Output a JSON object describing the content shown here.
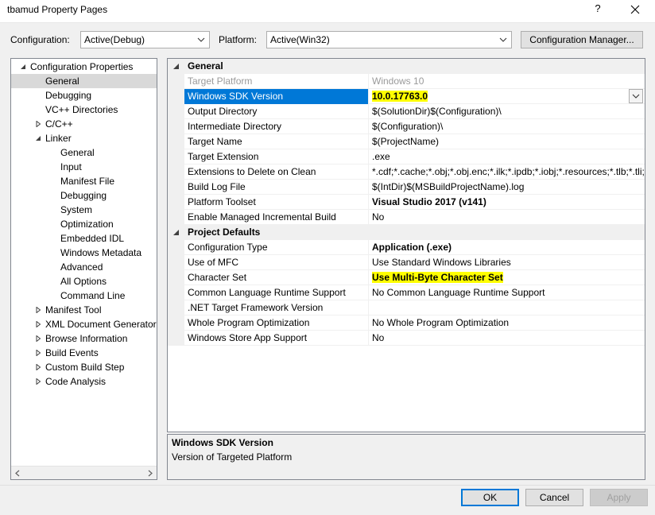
{
  "window": {
    "title": "tbamud Property Pages",
    "help_glyph": "?"
  },
  "config_bar": {
    "configuration_label": "Configuration:",
    "configuration_value": "Active(Debug)",
    "platform_label": "Platform:",
    "platform_value": "Active(Win32)",
    "manager_button": "Configuration Manager..."
  },
  "tree": {
    "items": [
      {
        "label": "Configuration Properties"
      },
      {
        "label": "General"
      },
      {
        "label": "Debugging"
      },
      {
        "label": "VC++ Directories"
      },
      {
        "label": "C/C++"
      },
      {
        "label": "Linker"
      },
      {
        "label": "General"
      },
      {
        "label": "Input"
      },
      {
        "label": "Manifest File"
      },
      {
        "label": "Debugging"
      },
      {
        "label": "System"
      },
      {
        "label": "Optimization"
      },
      {
        "label": "Embedded IDL"
      },
      {
        "label": "Windows Metadata"
      },
      {
        "label": "Advanced"
      },
      {
        "label": "All Options"
      },
      {
        "label": "Command Line"
      },
      {
        "label": "Manifest Tool"
      },
      {
        "label": "XML Document Generator"
      },
      {
        "label": "Browse Information"
      },
      {
        "label": "Build Events"
      },
      {
        "label": "Custom Build Step"
      },
      {
        "label": "Code Analysis"
      }
    ]
  },
  "grid": {
    "categories": [
      {
        "label": "General"
      },
      {
        "label": "Project Defaults"
      }
    ],
    "general_rows": [
      {
        "name": "Target Platform",
        "value": "Windows 10"
      },
      {
        "name": "Windows SDK Version",
        "value": "10.0.17763.0"
      },
      {
        "name": "Output Directory",
        "value": "$(SolutionDir)$(Configuration)\\"
      },
      {
        "name": "Intermediate Directory",
        "value": "$(Configuration)\\"
      },
      {
        "name": "Target Name",
        "value": "$(ProjectName)"
      },
      {
        "name": "Target Extension",
        "value": ".exe"
      },
      {
        "name": "Extensions to Delete on Clean",
        "value": "*.cdf;*.cache;*.obj;*.obj.enc;*.ilk;*.ipdb;*.iobj;*.resources;*.tlb;*.tli;"
      },
      {
        "name": "Build Log File",
        "value": "$(IntDir)$(MSBuildProjectName).log"
      },
      {
        "name": "Platform Toolset",
        "value": "Visual Studio 2017 (v141)"
      },
      {
        "name": "Enable Managed Incremental Build",
        "value": "No"
      }
    ],
    "defaults_rows": [
      {
        "name": "Configuration Type",
        "value": "Application (.exe)"
      },
      {
        "name": "Use of MFC",
        "value": "Use Standard Windows Libraries"
      },
      {
        "name": "Character Set",
        "value": "Use Multi-Byte Character Set"
      },
      {
        "name": "Common Language Runtime Support",
        "value": "No Common Language Runtime Support"
      },
      {
        "name": ".NET Target Framework Version",
        "value": ""
      },
      {
        "name": "Whole Program Optimization",
        "value": "No Whole Program Optimization"
      },
      {
        "name": "Windows Store App Support",
        "value": "No"
      }
    ]
  },
  "description": {
    "title": "Windows SDK Version",
    "text": "Version of Targeted Platform"
  },
  "buttons": {
    "ok": "OK",
    "cancel": "Cancel",
    "apply": "Apply"
  },
  "colors": {
    "selection": "#0078d7",
    "highlight": "#ffff00",
    "tree_selection": "#d9d9d9"
  }
}
